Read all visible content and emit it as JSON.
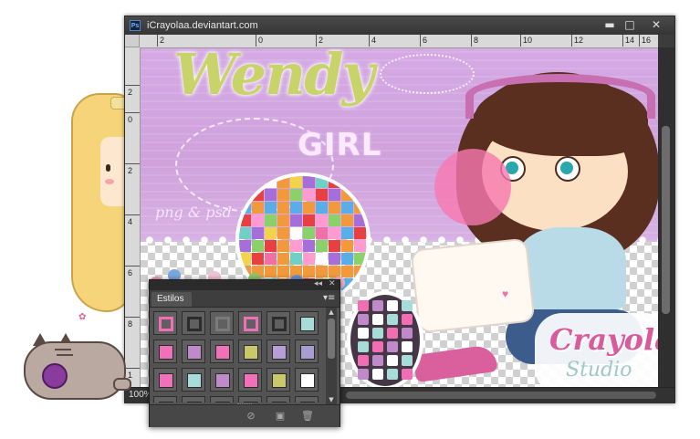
{
  "window": {
    "title": "iCrayolaa.deviantart.com",
    "app_icon": "Ps",
    "controls": {
      "minimize": "▬",
      "maximize": "□",
      "close": "✕"
    },
    "zoom": "100%"
  },
  "rulers": {
    "top": [
      "2",
      "0",
      "2",
      "4",
      "6",
      "8",
      "10",
      "12",
      "14",
      "16"
    ],
    "left": [
      "2",
      "0",
      "2",
      "4",
      "6",
      "8",
      "1"
    ]
  },
  "artwork": {
    "title": "Wendy",
    "subtitle": "GIRL",
    "tag": "png & psd",
    "brand": "Crayola",
    "brand_sub": "Studio",
    "heart": "♥"
  },
  "colors": {
    "swatches": [
      [
        "#f06fb4",
        "#2c2c2c",
        "#7a7a7a",
        "#f06fb4",
        "#2c2c2c",
        "#a8dcd9"
      ],
      [
        "#f071b8",
        "#c089c9",
        "#f071b8",
        "#c9c86a",
        "#b79ed6",
        "#a89dd0"
      ],
      [
        "#f071b8",
        "#a8dcd9",
        "#c089c9",
        "#f071b8",
        "#c9c86a",
        "#ffffff"
      ],
      [
        "#f071b8",
        "#a8dcd9",
        "#f071b8",
        "#7a7a7a",
        "#a8dcd9",
        "#c9c86a"
      ]
    ],
    "swatch_style": [
      [
        "ring",
        "ring",
        "ring",
        "ring",
        "ring",
        "fill"
      ],
      [
        "fill",
        "fill",
        "fill",
        "fill",
        "fill",
        "fill"
      ],
      [
        "fill",
        "fill",
        "fill",
        "fill",
        "fill",
        "fill"
      ],
      [
        "fill",
        "fill",
        "fill",
        "fill",
        "fill",
        "fill"
      ]
    ],
    "mosaic": [
      "#f06fa5",
      "#e84040",
      "#f3d34a",
      "#8ad16a",
      "#5aaee8",
      "#a56ed9",
      "#ffffff",
      "#ff9bd0",
      "#6fd1c5",
      "#f29a3b"
    ]
  },
  "panel": {
    "tab": "Estilos",
    "collapse": "◂◂",
    "close": "✕",
    "menu": "▾≡",
    "scroll_up": "▲",
    "scroll_down": "▼",
    "icons": {
      "clear": "⊘",
      "new": "▣",
      "delete": "🗑"
    }
  }
}
